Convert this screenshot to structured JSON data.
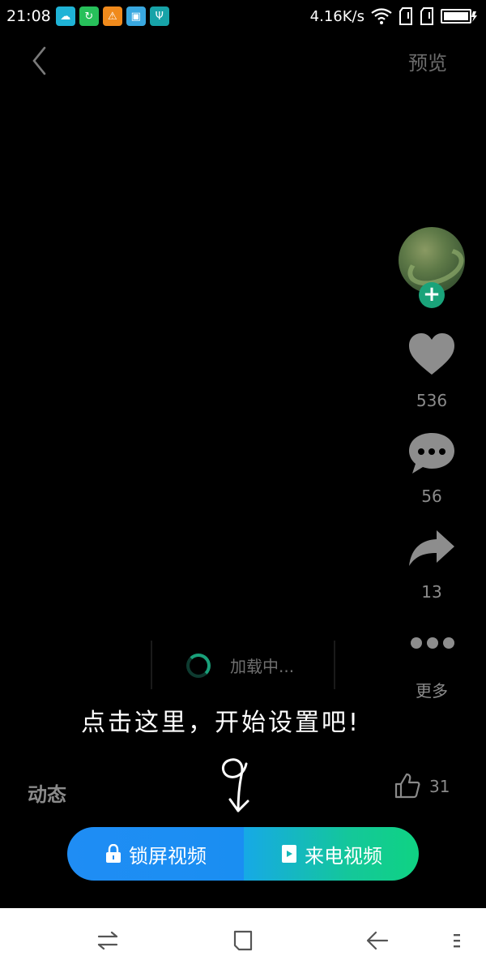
{
  "status_bar": {
    "time": "21:08",
    "net_speed": "4.16K/s",
    "notif_icons": [
      {
        "name": "app-notification-icon",
        "color": "#1fb3d6",
        "glyph": "☁"
      },
      {
        "name": "sync-notification-icon",
        "color": "#27c05a",
        "glyph": "↻"
      },
      {
        "name": "warning-notification-icon",
        "color": "#f08a1c",
        "glyph": "⚠"
      },
      {
        "name": "gallery-notification-icon",
        "color": "#39a8e0",
        "glyph": "▣"
      },
      {
        "name": "usb-notification-icon",
        "color": "#17a3a8",
        "glyph": "Ψ"
      }
    ]
  },
  "header": {
    "back_icon": "chevron-left-icon",
    "preview_label": "预览"
  },
  "actions": {
    "likes": "536",
    "comments": "56",
    "shares": "13",
    "more_label": "更多"
  },
  "loading": {
    "text": "加载中..."
  },
  "tip": {
    "text": "点击这里，开始设置吧!"
  },
  "feed": {
    "dynamic_label": "动态",
    "thumb_count": "31"
  },
  "cta": {
    "lock_label": "锁屏视频",
    "call_label": "来电视频",
    "lock_color": "#1f8df4",
    "call_color": "#0fd383"
  },
  "colors": {
    "follow": "#1aa37a",
    "spinner": "#19a07a"
  }
}
